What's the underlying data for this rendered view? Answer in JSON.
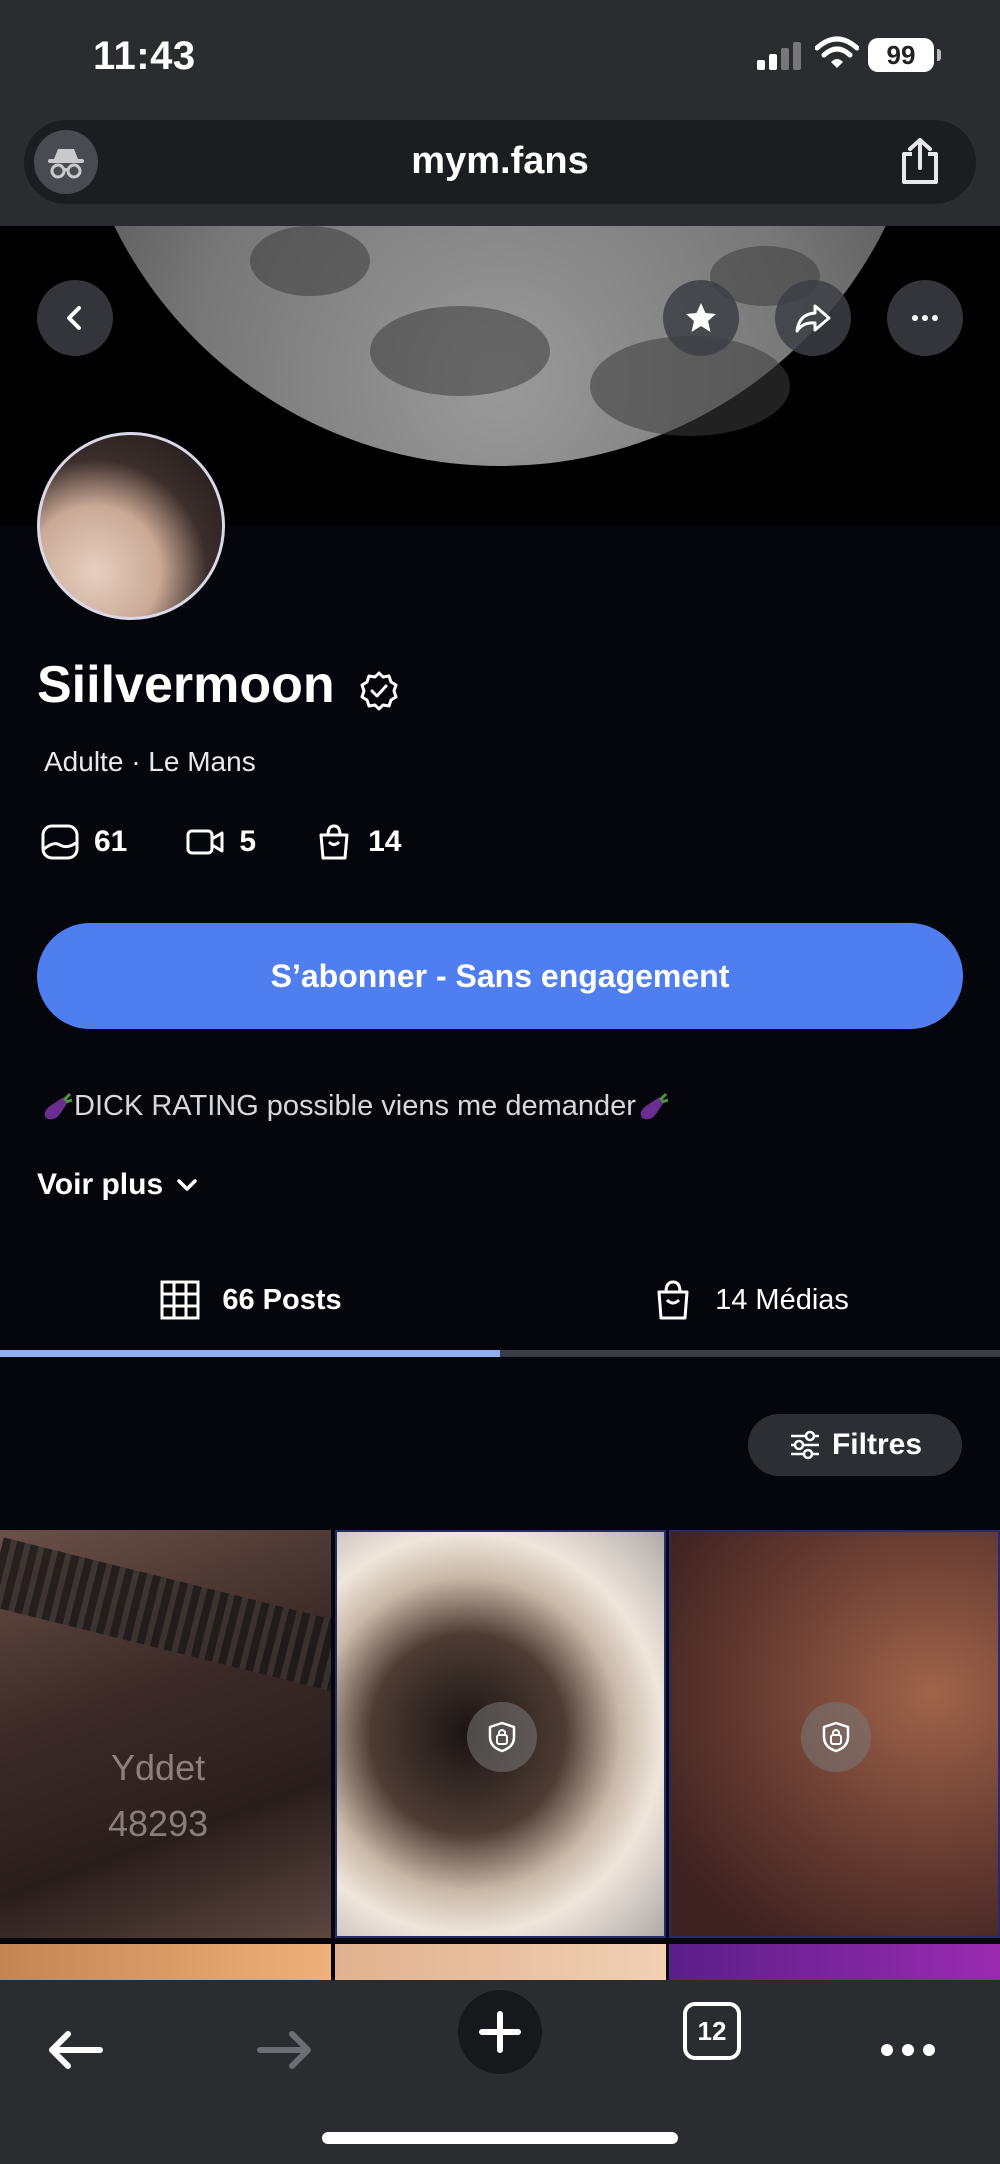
{
  "status_bar": {
    "time": "11:43",
    "battery": "99"
  },
  "browser": {
    "url": "mym.fans",
    "tab_count": "12"
  },
  "profile": {
    "name": "Siilvermoon",
    "category": "Adulte",
    "separator": "·",
    "location": "Le Mans",
    "stats": {
      "photos": "61",
      "videos": "5",
      "medias": "14"
    },
    "subscribe_label": "S’abonner - Sans engagement",
    "bio": "DICK RATING possible viens me demander",
    "see_more": "Voir plus"
  },
  "tabs": [
    {
      "label": "66 Posts",
      "active": true
    },
    {
      "label": "14 Médias",
      "active": false
    }
  ],
  "filters_label": "Filtres",
  "grid": {
    "watermark_line1": "Yddet",
    "watermark_line2": "48293"
  },
  "colors": {
    "accent": "#4f7ef1",
    "tab_indicator": "#8fb0ef",
    "background": "#04060b"
  }
}
